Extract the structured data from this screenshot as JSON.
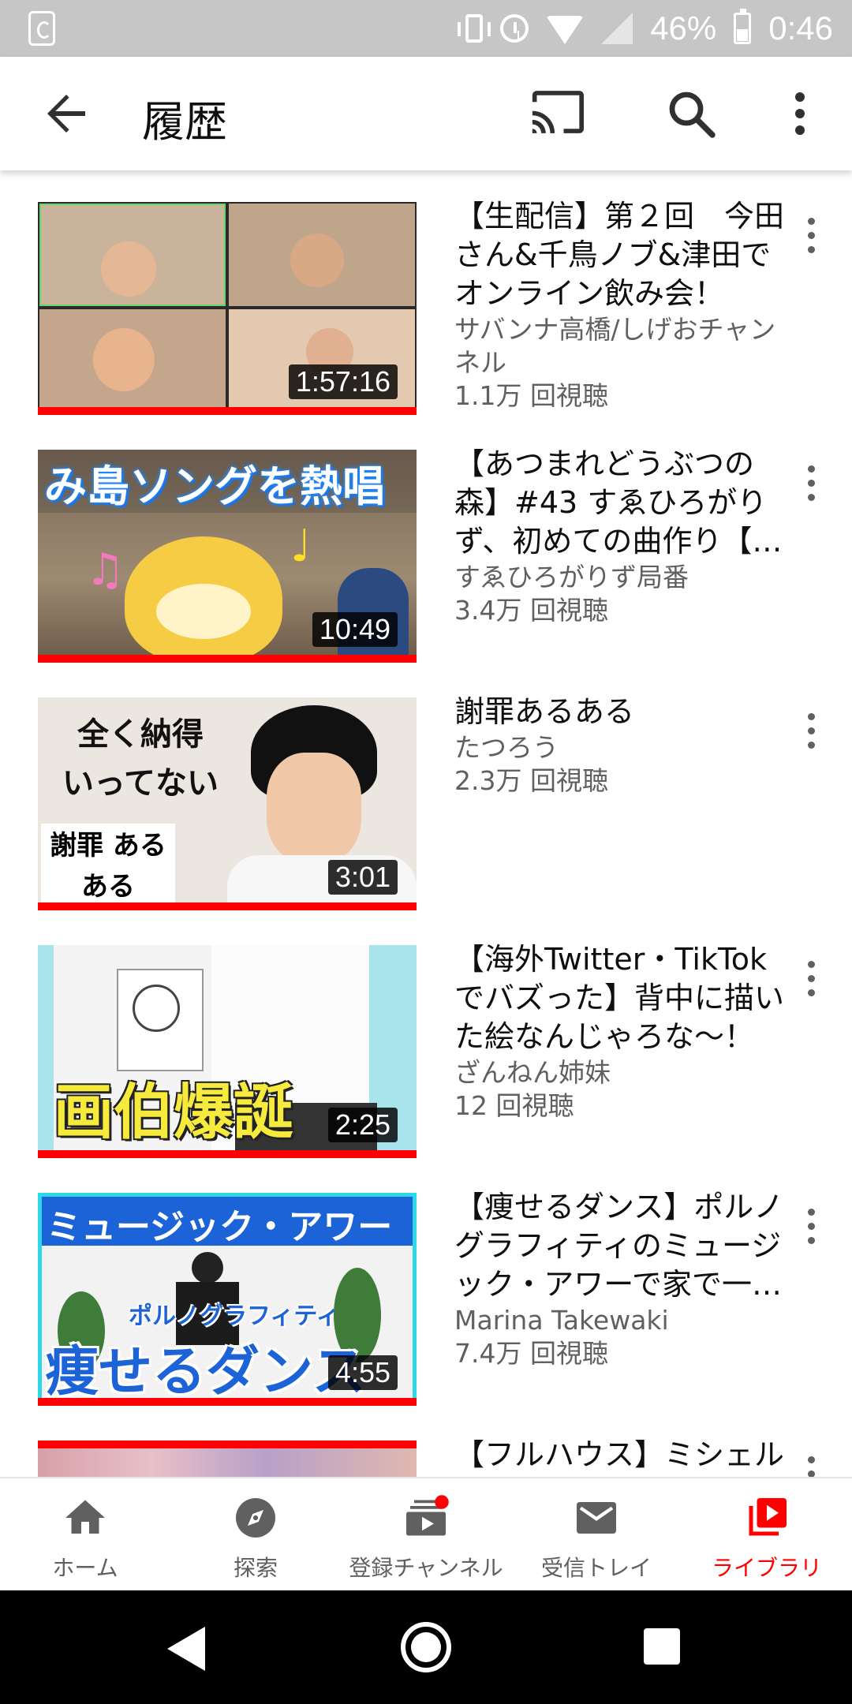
{
  "status_bar": {
    "battery": "46%",
    "time": "0:46"
  },
  "app_bar": {
    "title": "履歴",
    "icons": [
      "back-arrow-icon",
      "cast-icon",
      "search-icon",
      "more-vert-icon"
    ]
  },
  "videos": [
    {
      "title": "【生配信】第２回　今田さん&千鳥ノブ&津田でオンライン飲み会！",
      "channel": "サバンナ高橋/しげおチャンネル",
      "views": "1.1万 回視聴",
      "duration": "1:57:16",
      "watched_fraction": 1.0
    },
    {
      "title": "【あつまれどうぶつの森】#43 すゑひろがりず、初めての曲作り【…",
      "channel": "すゑひろがりず局番",
      "views": "3.4万 回視聴",
      "duration": "10:49",
      "watched_fraction": 1.0,
      "thumb_text": "み島ソングを熱唱"
    },
    {
      "title": "謝罪あるある",
      "channel": "たつろう",
      "views": "2.3万 回視聴",
      "duration": "3:01",
      "watched_fraction": 1.0,
      "thumb_text": "全く納得 いってない",
      "thumb_text2": "謝罪 あるある"
    },
    {
      "title": "【海外Twitter・TikTokでバズった】背中に描いた絵なんじゃろな～！",
      "channel": "ざんねん姉妹",
      "views": "12 回視聴",
      "duration": "2:25",
      "watched_fraction": 1.0,
      "thumb_text": "画伯爆誕"
    },
    {
      "title": "【痩せるダンス】ポルノグラフィティのミュージック・アワーで家で一…",
      "channel": "Marina Takewaki",
      "views": "7.4万 回視聴",
      "duration": "4:55",
      "watched_fraction": 1.0,
      "thumb_text": "ミュージック・アワー",
      "thumb_text2": "ポルノグラフィティ",
      "thumb_text3": "痩せるダンス"
    },
    {
      "title": "【フルハウス】ミシェル",
      "channel": "",
      "views": "",
      "duration": "",
      "watched_fraction": 1.0
    }
  ],
  "bottom_nav": [
    {
      "label": "ホーム",
      "icon": "home-icon",
      "active": false
    },
    {
      "label": "探索",
      "icon": "compass-icon",
      "active": false
    },
    {
      "label": "登録チャンネル",
      "icon": "subscriptions-icon",
      "active": false,
      "badge": true
    },
    {
      "label": "受信トレイ",
      "icon": "inbox-mail-icon",
      "active": false
    },
    {
      "label": "ライブラリ",
      "icon": "library-icon",
      "active": true
    }
  ],
  "colors": {
    "accent": "#ff0000",
    "secondary_text": "#606060",
    "status_bar": "#c6c6c6"
  }
}
